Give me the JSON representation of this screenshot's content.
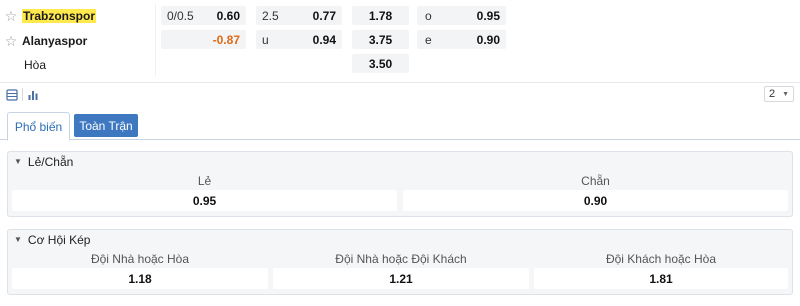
{
  "match": {
    "home": "Trabzonspor",
    "away": "Alanyaspor",
    "draw": "Hòa",
    "rows": [
      {
        "hc_line": "0/0.5",
        "hc_odds": "0.60",
        "ou_line": "2.5",
        "ou_odds": "0.77",
        "x12": "1.78",
        "oe_label": "o",
        "oe_odds": "0.95"
      },
      {
        "hc_line": "",
        "hc_odds": "-0.87",
        "ou_line": "u",
        "ou_odds": "0.94",
        "x12": "3.75",
        "oe_label": "e",
        "oe_odds": "0.90"
      },
      {
        "x12": "3.50"
      }
    ]
  },
  "toolbar": {
    "page_value": "2",
    "icons": [
      "list-icon",
      "bar-chart-icon",
      "chevron-down-icon"
    ]
  },
  "tabs": [
    {
      "label": "Phổ biến",
      "active": true
    },
    {
      "label": "Toàn Trận",
      "active": false
    }
  ],
  "markets": [
    {
      "title": "Lẻ/Chẵn",
      "selections": [
        {
          "label": "Lẻ",
          "odds": "0.95"
        },
        {
          "label": "Chẵn",
          "odds": "0.90"
        }
      ]
    },
    {
      "title": "Cơ Hội Kép",
      "selections": [
        {
          "label": "Đội Nhà hoặc Hòa",
          "odds": "1.18"
        },
        {
          "label": "Đội Nhà hoặc Đội Khách",
          "odds": "1.21"
        },
        {
          "label": "Đội Khách hoặc Hòa",
          "odds": "1.81"
        }
      ]
    }
  ],
  "colors": {
    "highlight": "#ffe94d",
    "negative_odds": "#e06a14",
    "tab_active_text": "#2a6fb8",
    "tab_button_bg": "#3d78c0"
  }
}
